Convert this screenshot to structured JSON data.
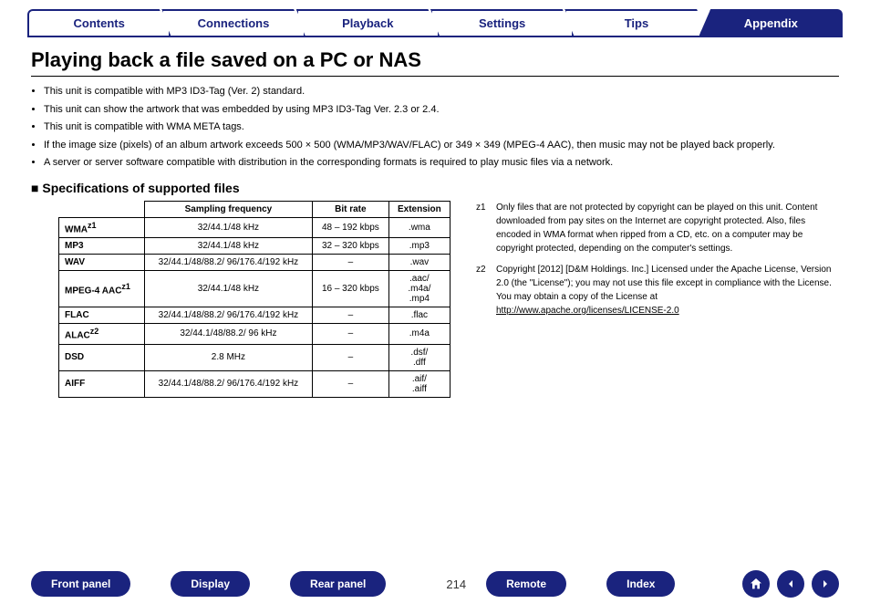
{
  "topnav": {
    "tabs": [
      "Contents",
      "Connections",
      "Playback",
      "Settings",
      "Tips",
      "Appendix"
    ],
    "active_index": 5
  },
  "title": "Playing back a file saved on a PC or NAS",
  "bullets": [
    "This unit is compatible with MP3 ID3-Tag (Ver. 2) standard.",
    "This unit can show the artwork that was embedded by using MP3 ID3-Tag Ver. 2.3 or 2.4.",
    "This unit is compatible with WMA META tags.",
    "If the image size (pixels) of an album artwork exceeds 500 × 500 (WMA/MP3/WAV/FLAC) or 349 × 349 (MPEG-4 AAC), then music may not be played back properly.",
    "A server or server software compatible with distribution in the corresponding formats is required to play music files via a network."
  ],
  "spec_title": "Specifications of supported files",
  "spec_headers": [
    "Sampling frequency",
    "Bit rate",
    "Extension"
  ],
  "spec_rows": [
    {
      "format": "WMA",
      "note": "z1",
      "sampling": "32/44.1/48 kHz",
      "bitrate": "48 – 192 kbps",
      "ext": ".wma"
    },
    {
      "format": "MP3",
      "note": "",
      "sampling": "32/44.1/48 kHz",
      "bitrate": "32 – 320 kbps",
      "ext": ".mp3"
    },
    {
      "format": "WAV",
      "note": "",
      "sampling": "32/44.1/48/88.2/ 96/176.4/192 kHz",
      "bitrate": "–",
      "ext": ".wav"
    },
    {
      "format": "MPEG-4 AAC",
      "note": "z1",
      "sampling": "32/44.1/48 kHz",
      "bitrate": "16 – 320 kbps",
      "ext": ".aac/ .m4a/ .mp4"
    },
    {
      "format": "FLAC",
      "note": "",
      "sampling": "32/44.1/48/88.2/ 96/176.4/192 kHz",
      "bitrate": "–",
      "ext": ".flac"
    },
    {
      "format": "ALAC",
      "note": "z2",
      "sampling": "32/44.1/48/88.2/ 96 kHz",
      "bitrate": "–",
      "ext": ".m4a"
    },
    {
      "format": "DSD",
      "note": "",
      "sampling": "2.8 MHz",
      "bitrate": "–",
      "ext": ".dsf/ .dff"
    },
    {
      "format": "AIFF",
      "note": "",
      "sampling": "32/44.1/48/88.2/ 96/176.4/192 kHz",
      "bitrate": "–",
      "ext": ".aif/ .aiff"
    }
  ],
  "footnotes": [
    {
      "label": "z1",
      "text": "Only files that are not protected by copyright can be played on this unit. Content downloaded from pay sites on the Internet are copyright protected. Also, files encoded in WMA format when ripped from a CD, etc. on a computer may be copyright protected, depending on the computer's settings."
    },
    {
      "label": "z2",
      "text": "Copyright [2012] [D&M Holdings. Inc.] Licensed under the Apache License, Version 2.0 (the \"License\"); you may not use this file except in compliance with the License. You may obtain a copy of the License at",
      "link": "http://www.apache.org/licenses/LICENSE-2.0"
    }
  ],
  "bottomnav": {
    "buttons": [
      "Front panel",
      "Display",
      "Rear panel"
    ],
    "page": "214",
    "buttons2": [
      "Remote",
      "Index"
    ]
  }
}
